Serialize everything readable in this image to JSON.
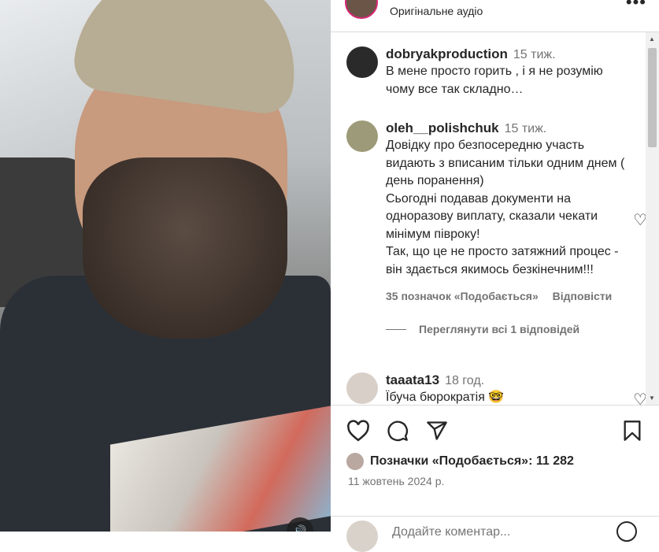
{
  "header": {
    "subtitle": "Оригінальне аудіо",
    "more_label": "•••"
  },
  "comments": [
    {
      "user": "dobryakproduction",
      "time": "15 тиж.",
      "text": "В мене просто горить , і я не розумію чому все так складно…"
    },
    {
      "user": "oleh__polishchuk",
      "time": "15 тиж.",
      "text": "Довідку про безпосередню участь видають з вписаним тільки одним днем ( день поранення)\nСьогодні подавав документи на одноразову виплату, сказали чекати мінімум півроку!\nТак, що це не просто затяжний процес - він здається якимось безкінечним!!!",
      "likes": "35 позначок «Подобається»",
      "reply_label": "Відповісти",
      "view_replies": "Переглянути всі 1 відповідей"
    },
    {
      "user": "taaata13",
      "time": "18 год.",
      "text": "Їбуча бюрократія 🤓"
    }
  ],
  "post": {
    "likes_text": "Позначки «Подобається»: 11 282",
    "date": "11 жовтень 2024 р.",
    "comment_placeholder": "Додайте коментар..."
  },
  "icons": {
    "heart": "heart-icon",
    "comment": "comment-icon",
    "share": "share-icon",
    "save": "bookmark-icon",
    "emoji": "emoji-icon",
    "mute": "speaker-icon"
  }
}
